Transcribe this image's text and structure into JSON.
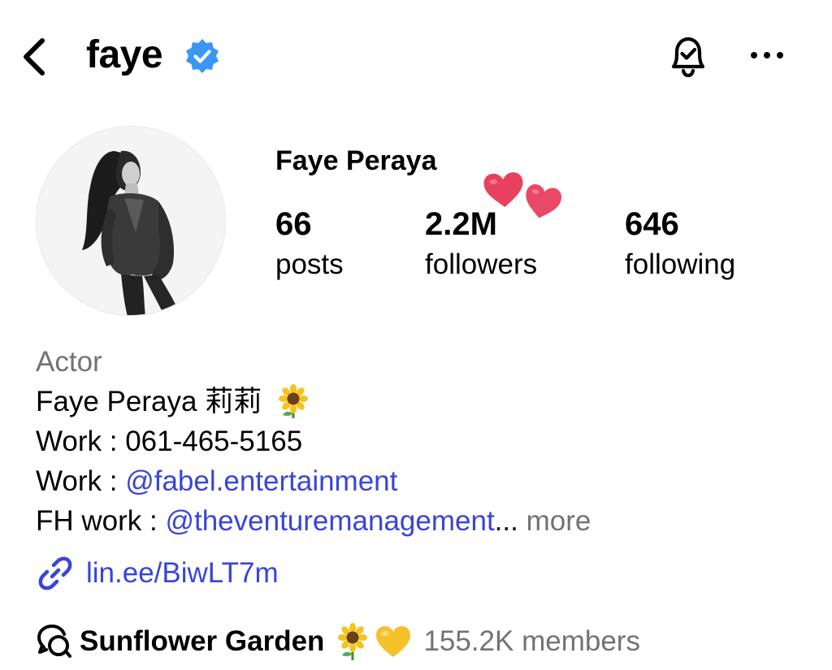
{
  "header": {
    "username": "faye",
    "back_icon": "chevron-left-icon",
    "verified_icon": "verified-badge-icon",
    "notification_icon": "bell-check-icon",
    "more_icon": "more-horizontal-icon"
  },
  "profile": {
    "full_name": "Faye Peraya",
    "stats": [
      {
        "value": "66",
        "label": "posts"
      },
      {
        "value": "2.2M",
        "label": "followers"
      },
      {
        "value": "646",
        "label": "following"
      }
    ]
  },
  "bio": {
    "category": "Actor",
    "line1": "Faye Peraya 莉莉",
    "line2": "Work : 061-465-5165",
    "line3_prefix": "Work : ",
    "line3_mention": "@fabel.entertainment",
    "line4_prefix": "FH work : ",
    "line4_mention": "@theventuremanagement",
    "line4_ellipsis": "...",
    "more": " more",
    "link": "lin.ee/BiwLT7m"
  },
  "channel": {
    "name": "Sunflower Garden",
    "members": "155.2K members"
  },
  "colors": {
    "link_blue": "#3845d9",
    "verified_blue": "#3897f0",
    "secondary_text": "#737373",
    "heart_pink": "#e8405f"
  }
}
